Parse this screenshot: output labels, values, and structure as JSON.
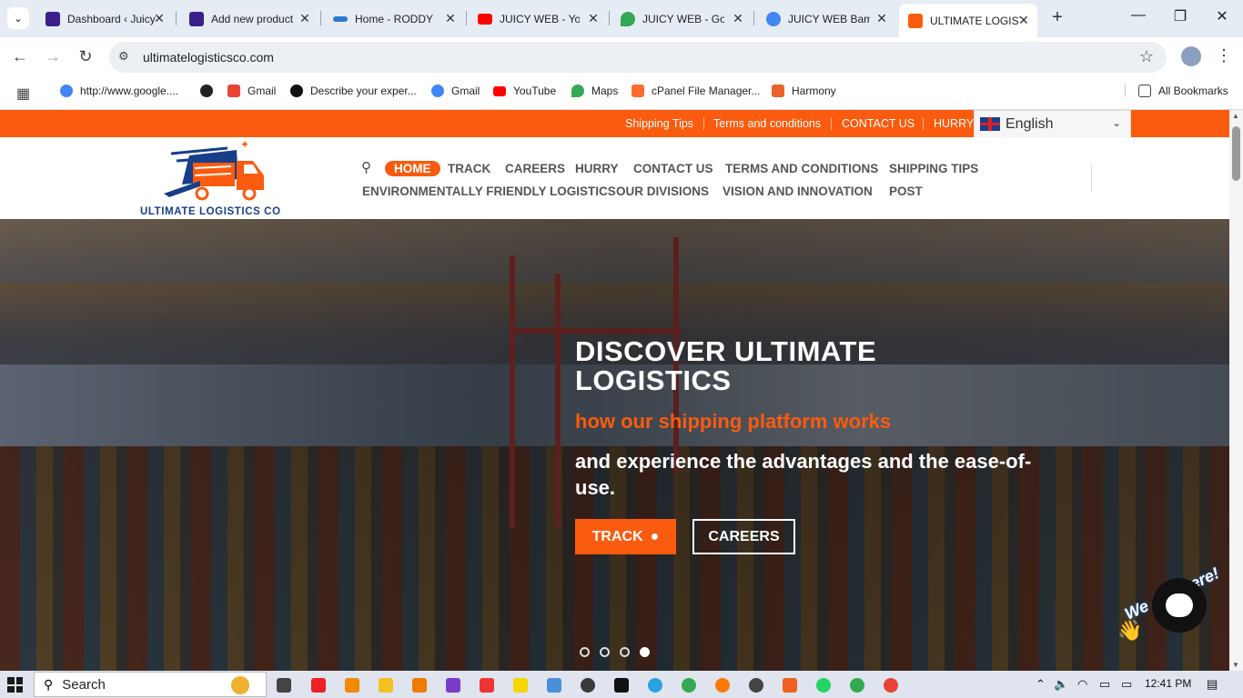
{
  "browser": {
    "tabs": [
      {
        "title": "Dashboard ‹ Juicy",
        "color": "#3b1f8a"
      },
      {
        "title": "Add new product",
        "color": "#3b1f8a"
      },
      {
        "title": "Home - RODDY",
        "color": "#2b7bd0"
      },
      {
        "title": "JUICY WEB - YouTube",
        "color": "#ff0000"
      },
      {
        "title": "JUICY WEB - Google Maps",
        "color": "#34a853"
      },
      {
        "title": "JUICY WEB Bamenda",
        "color": "#4285f4"
      },
      {
        "title": "ULTIMATE LOGISTICS",
        "color": "#fb5b0e"
      }
    ],
    "new_tab": "+",
    "minimize": "—",
    "restore": "❐",
    "close": "✕",
    "url": "ultimatelogisticsco.com",
    "bookmarks": [
      {
        "label": "http://www.google....",
        "color": "#4285f4"
      },
      {
        "label": "",
        "color": "#222"
      },
      {
        "label": "Gmail",
        "color": "#ea4335"
      },
      {
        "label": "Describe your exper...",
        "color": "#111"
      },
      {
        "label": "Gmail",
        "color": "#4285f4"
      },
      {
        "label": "YouTube",
        "color": "#ff0000"
      },
      {
        "label": "Maps",
        "color": "#34a853"
      },
      {
        "label": "cPanel File Manager...",
        "color": "#ff6c2c"
      },
      {
        "label": "Harmony",
        "color": "#e8622a"
      }
    ],
    "all_bookmarks": "All Bookmarks"
  },
  "site": {
    "topbar_links": [
      "Shipping Tips",
      "Terms and conditions",
      "CONTACT US",
      "HURRY"
    ],
    "language": "English",
    "brand": "ULTIMATE LOGISTICS CO",
    "nav_row1": [
      "HOME",
      "TRACK",
      "CAREERS",
      "HURRY",
      "CONTACT US",
      "TERMS AND CONDITIONS",
      "SHIPPING TIPS"
    ],
    "nav_row2": [
      "ENVIRONMENTALLY FRIENDLY LOGISTICS",
      "OUR DIVISIONS",
      "VISION AND INNOVATION",
      "POST"
    ],
    "hero": {
      "title": "DISCOVER ULTIMATE LOGISTICS",
      "subtitle": "how our shipping platform works",
      "body": "and experience the advantages and the ease-of-use.",
      "btn_track": "TRACK",
      "btn_careers": "CAREERS",
      "slides": 4,
      "active_slide": 4
    },
    "chat": {
      "label": "We Are Here!",
      "close": "✕"
    }
  },
  "taskbar": {
    "search": "Search",
    "time": "12:41 PM"
  },
  "colors": {
    "accent": "#fb5b0e",
    "brand_blue": "#173e8a"
  }
}
